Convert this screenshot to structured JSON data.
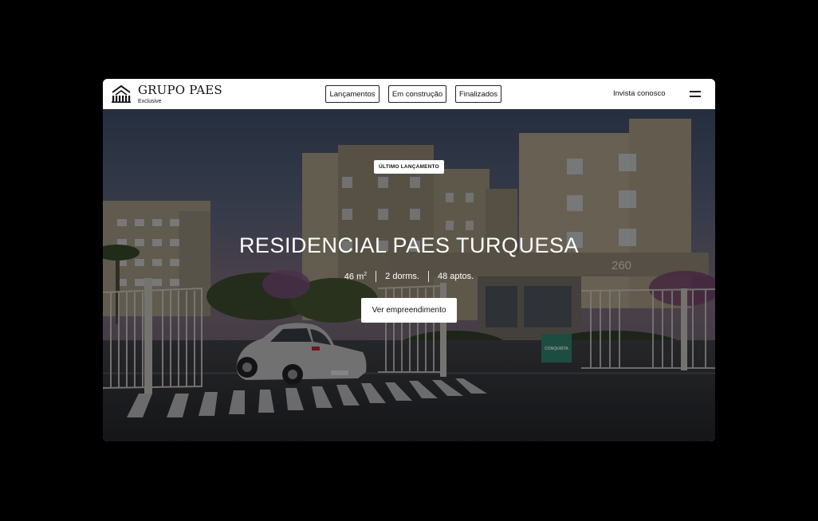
{
  "header": {
    "brand": {
      "name": "GRUPO PAES",
      "subtitle": "Exclusive",
      "logo_icon": "house-building-logo-icon"
    },
    "nav": [
      {
        "label": "Lançamentos"
      },
      {
        "label": "Em construção"
      },
      {
        "label": "Finalizados"
      }
    ],
    "invest_label": "Invista conosco",
    "menu_icon": "hamburger-menu-icon"
  },
  "hero": {
    "badge": "ÚLTIMO LANÇAMENTO",
    "title": "RESIDENCIAL PAES TURQUESA",
    "specs": [
      {
        "area": "46 m",
        "area_sup": "2"
      },
      {
        "text": "2 dorms."
      },
      {
        "text": "48 aptos."
      }
    ],
    "cta_label": "Ver empreendimento",
    "building_number": "260",
    "sign_text": "CONQUISTA"
  },
  "colors": {
    "page_background": "#000000",
    "header_background": "#ffffff",
    "hero_text": "#ffffff",
    "button_background": "#ffffff"
  }
}
